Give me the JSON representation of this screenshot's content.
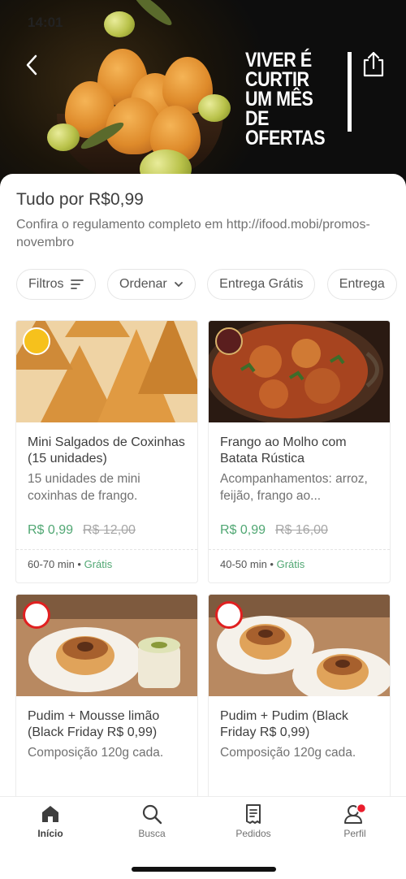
{
  "status_bar": {
    "time": "14:01"
  },
  "banner": {
    "promo_lines": [
      "VIVER É",
      "CURTIR",
      "UM MÊS DE",
      "OFERTAS"
    ]
  },
  "page": {
    "title": "Tudo por R$0,99",
    "subtitle": "Confira o regulamento completo em http://ifood.mobi/promos-novembro"
  },
  "filters": [
    {
      "label": "Filtros",
      "icon": "filter-lines-icon"
    },
    {
      "label": "Ordenar",
      "icon": "chevron-down-icon"
    },
    {
      "label": "Entrega Grátis",
      "icon": ""
    },
    {
      "label": "Entrega",
      "icon": ""
    }
  ],
  "products": [
    {
      "name": "Mini Salgados de Coxinhas (15 unidades)",
      "description": "15 unidades de mini coxinhas de frango.",
      "price": "R$ 0,99",
      "old_price": "R$ 12,00",
      "eta": "60-70 min",
      "delivery": "Grátis"
    },
    {
      "name": "Frango ao Molho com Batata Rústica",
      "description": "Acompanhamentos: arroz, feijão, frango ao...",
      "price": "R$ 0,99",
      "old_price": "R$ 16,00",
      "eta": "40-50 min",
      "delivery": "Grátis"
    },
    {
      "name": "Pudim + Mousse limão (Black Friday R$ 0,99)",
      "description": "Composição 120g cada."
    },
    {
      "name": "Pudim + Pudim (Black Friday R$ 0,99)",
      "description": "Composição 120g cada."
    }
  ],
  "bottom_nav": [
    {
      "label": "Início",
      "icon": "home-icon",
      "active": true
    },
    {
      "label": "Busca",
      "icon": "search-icon",
      "active": false
    },
    {
      "label": "Pedidos",
      "icon": "receipt-icon",
      "active": false
    },
    {
      "label": "Perfil",
      "icon": "profile-icon",
      "active": false
    }
  ],
  "colors": {
    "price_green": "#50a773",
    "notification_red": "#ea1d2c",
    "banner_bg": "#0d0d0d"
  }
}
